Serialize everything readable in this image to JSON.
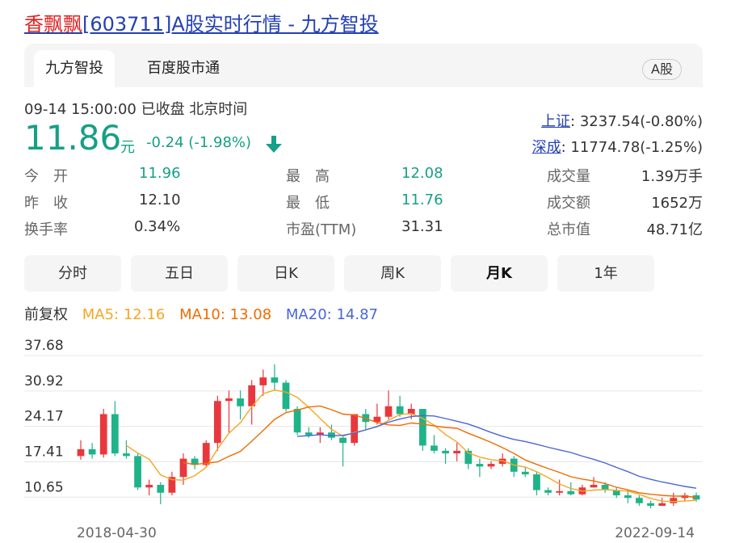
{
  "page_title": {
    "stock_name": "香飘飘",
    "rest": "[603711]A股实时行情 - 九方智投"
  },
  "tabs": {
    "active": "九方智投",
    "second": "百度股市通",
    "market_badge": "A股"
  },
  "quote": {
    "timeline": "09-14 15:00:00  已收盘  北京时间",
    "price": "11.86",
    "unit": "元",
    "change": "-0.24 (-1.98%)",
    "colors": {
      "down": "#16a085",
      "link": "#2440b3",
      "stock_name": "#e02222"
    }
  },
  "indices": [
    {
      "name": "上证",
      "value": ": 3237.54(-0.80%)"
    },
    {
      "name": "深成",
      "value": ": 11774.78(-1.25%)"
    }
  ],
  "stats": {
    "open_label": "今　开",
    "open": "11.96",
    "prev_label": "昨　收",
    "prev": "12.10",
    "turnover_label": "换手率",
    "turnover": "0.34%",
    "high_label": "最　高",
    "high": "12.08",
    "low_label": "最　低",
    "low": "11.76",
    "pe_label": "市盈(TTM)",
    "pe": "31.31",
    "volume_label": "成交量",
    "volume": "1.39万手",
    "amount_label": "成交额",
    "amount": "1652万",
    "mcap_label": "总市值",
    "mcap": "48.71亿"
  },
  "periods": [
    "分时",
    "五日",
    "日K",
    "周K",
    "月K",
    "1年"
  ],
  "active_period": "月K",
  "ma_legend": {
    "adjust": "前复权",
    "ma5": "MA5: 12.16",
    "ma10": "MA10: 13.08",
    "ma20": "MA20: 14.87",
    "colors": {
      "ma5": "#f5a623",
      "ma10": "#ef6c00",
      "ma20": "#4a66d6"
    }
  },
  "chart_data": {
    "type": "candlestick",
    "y_ticks": [
      "37.68",
      "30.92",
      "24.17",
      "17.41",
      "10.65"
    ],
    "ylim": [
      7.3,
      37.68
    ],
    "x_start_label": "2018-04-30",
    "x_end_label": "2022-09-14",
    "colors": {
      "up": "#e8373d",
      "down": "#1fb38a"
    },
    "candles": [
      [
        18.5,
        19.8,
        21.5,
        17.8
      ],
      [
        19.8,
        18.8,
        21.0,
        18.0
      ],
      [
        18.8,
        26.5,
        27.5,
        18.2
      ],
      [
        26.5,
        19.0,
        29.0,
        18.5
      ],
      [
        19.0,
        18.5,
        21.5,
        18.0
      ],
      [
        18.5,
        12.5,
        19.0,
        12.0
      ],
      [
        12.5,
        13.0,
        14.0,
        11.0
      ],
      [
        13.0,
        11.5,
        13.5,
        9.3
      ],
      [
        11.5,
        14.5,
        15.5,
        11.0
      ],
      [
        14.5,
        18.0,
        19.0,
        13.0
      ],
      [
        18.0,
        16.8,
        18.5,
        16.0
      ],
      [
        16.8,
        21.0,
        21.5,
        16.5
      ],
      [
        21.0,
        29.0,
        30.0,
        19.5
      ],
      [
        29.0,
        29.5,
        31.0,
        23.0
      ],
      [
        29.5,
        28.0,
        31.0,
        25.5
      ],
      [
        28.0,
        32.0,
        33.0,
        24.5
      ],
      [
        32.0,
        33.5,
        35.0,
        30.0
      ],
      [
        33.5,
        32.5,
        36.0,
        31.0
      ],
      [
        32.5,
        27.5,
        33.0,
        27.0
      ],
      [
        27.5,
        23.0,
        28.0,
        22.5
      ],
      [
        23.0,
        22.5,
        24.0,
        22.0
      ],
      [
        22.5,
        23.0,
        24.0,
        21.0
      ],
      [
        23.0,
        22.0,
        24.5,
        21.5
      ],
      [
        22.0,
        21.0,
        22.5,
        16.5
      ],
      [
        21.0,
        26.5,
        26.5,
        20.5
      ],
      [
        26.5,
        25.0,
        27.5,
        23.5
      ],
      [
        25.0,
        26.0,
        28.5,
        24.5
      ],
      [
        26.0,
        28.0,
        31.0,
        25.5
      ],
      [
        28.0,
        26.5,
        30.0,
        26.0
      ],
      [
        26.5,
        27.5,
        28.5,
        25.5
      ],
      [
        27.5,
        20.5,
        27.5,
        19.5
      ],
      [
        20.5,
        19.5,
        22.5,
        19.0
      ],
      [
        19.5,
        19.0,
        20.0,
        17.0
      ],
      [
        19.0,
        19.5,
        21.0,
        17.5
      ],
      [
        19.5,
        17.0,
        20.0,
        16.0
      ],
      [
        17.0,
        16.5,
        18.0,
        14.5
      ],
      [
        16.5,
        17.0,
        17.5,
        16.0
      ],
      [
        17.0,
        18.0,
        19.0,
        16.5
      ],
      [
        18.0,
        15.5,
        18.5,
        14.5
      ],
      [
        15.5,
        15.0,
        16.5,
        14.5
      ],
      [
        15.0,
        12.0,
        15.5,
        11.0
      ],
      [
        12.0,
        11.5,
        12.5,
        11.0
      ],
      [
        11.5,
        11.8,
        14.0,
        11.0
      ],
      [
        11.8,
        11.2,
        13.5,
        11.0
      ],
      [
        11.2,
        12.5,
        13.0,
        11.0
      ],
      [
        12.5,
        13.0,
        14.5,
        12.5
      ],
      [
        13.0,
        12.0,
        13.5,
        11.5
      ],
      [
        12.0,
        11.0,
        12.5,
        10.5
      ],
      [
        11.0,
        10.5,
        12.0,
        9.5
      ],
      [
        10.5,
        9.5,
        11.0,
        9.0
      ],
      [
        9.5,
        9.0,
        10.0,
        8.5
      ],
      [
        9.0,
        9.5,
        10.5,
        9.0
      ],
      [
        9.5,
        10.5,
        11.5,
        9.0
      ],
      [
        10.5,
        11.0,
        11.5,
        10.0
      ],
      [
        11.0,
        10.2,
        11.5,
        9.8
      ]
    ]
  }
}
